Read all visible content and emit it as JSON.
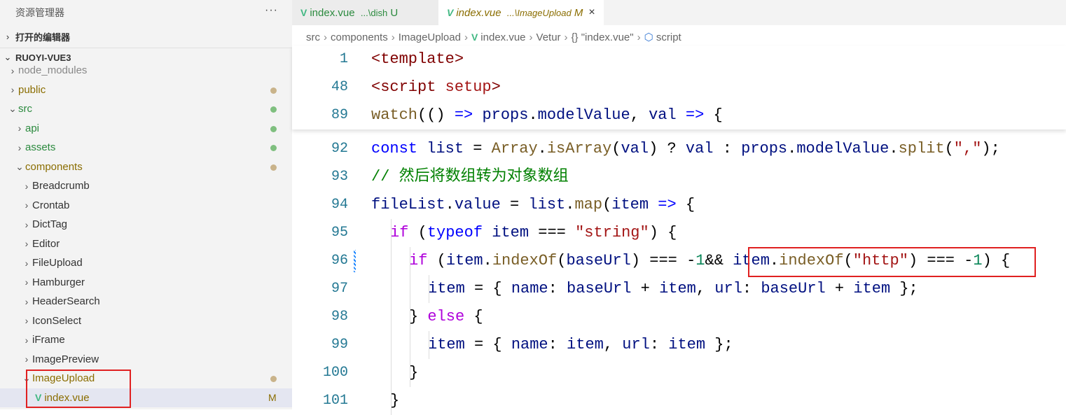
{
  "sidebar": {
    "title": "资源管理器",
    "more": "···",
    "open_editors": "打开的编辑器",
    "project": "RUOYI-VUE3",
    "items": [
      {
        "label": "node_modules",
        "depth": 1,
        "expanded": false,
        "color": "#888",
        "dot": null
      },
      {
        "label": "public",
        "depth": 1,
        "expanded": false,
        "color": "#8a6d00",
        "dot": "#c9b38a"
      },
      {
        "label": "src",
        "depth": 1,
        "expanded": true,
        "color": "#2b8a3e",
        "dot": "#7fbf7f"
      },
      {
        "label": "api",
        "depth": 2,
        "expanded": false,
        "color": "#2b8a3e",
        "dot": "#7fbf7f"
      },
      {
        "label": "assets",
        "depth": 2,
        "expanded": false,
        "color": "#2b8a3e",
        "dot": "#7fbf7f"
      },
      {
        "label": "components",
        "depth": 2,
        "expanded": true,
        "color": "#8a6d00",
        "dot": "#c9b38a"
      },
      {
        "label": "Breadcrumb",
        "depth": 3,
        "expanded": false,
        "color": "#333",
        "dot": null
      },
      {
        "label": "Crontab",
        "depth": 3,
        "expanded": false,
        "color": "#333",
        "dot": null
      },
      {
        "label": "DictTag",
        "depth": 3,
        "expanded": false,
        "color": "#333",
        "dot": null
      },
      {
        "label": "Editor",
        "depth": 3,
        "expanded": false,
        "color": "#333",
        "dot": null
      },
      {
        "label": "FileUpload",
        "depth": 3,
        "expanded": false,
        "color": "#333",
        "dot": null
      },
      {
        "label": "Hamburger",
        "depth": 3,
        "expanded": false,
        "color": "#333",
        "dot": null
      },
      {
        "label": "HeaderSearch",
        "depth": 3,
        "expanded": false,
        "color": "#333",
        "dot": null
      },
      {
        "label": "IconSelect",
        "depth": 3,
        "expanded": false,
        "color": "#333",
        "dot": null
      },
      {
        "label": "iFrame",
        "depth": 3,
        "expanded": false,
        "color": "#333",
        "dot": null
      },
      {
        "label": "ImagePreview",
        "depth": 3,
        "expanded": false,
        "color": "#333",
        "dot": null
      },
      {
        "label": "ImageUpload",
        "depth": 3,
        "expanded": true,
        "color": "#8a6d00",
        "dot": "#c9b38a"
      },
      {
        "label": "index.vue",
        "depth": 4,
        "file": true,
        "color": "#8a6d00",
        "badge": "M",
        "selected": true
      }
    ]
  },
  "tabs": [
    {
      "name": "index.vue",
      "path": "...\\dish",
      "status": "U"
    },
    {
      "name": "index.vue",
      "path": "...\\ImageUpload",
      "status": "M",
      "close": "×"
    }
  ],
  "breadcrumb": [
    "src",
    "components",
    "ImageUpload",
    "index.vue",
    "Vetur",
    "{} \"index.vue\"",
    "script"
  ],
  "sticky": [
    {
      "n": "1",
      "t": [
        [
          "<template>",
          "tg"
        ]
      ]
    },
    {
      "n": "48",
      "t": [
        [
          "<script ",
          "tg"
        ],
        [
          "setup",
          "st"
        ],
        [
          ">",
          "tg"
        ]
      ]
    },
    {
      "n": "89",
      "t": [
        [
          "watch",
          "fn"
        ],
        [
          "(() ",
          ""
        ],
        [
          "=>",
          "bl"
        ],
        [
          " ",
          ""
        ],
        [
          "props",
          "vr"
        ],
        [
          ".",
          ""
        ],
        [
          "modelValue",
          "vr"
        ],
        [
          ", ",
          ""
        ],
        [
          "val",
          "vr"
        ],
        [
          " ",
          ""
        ],
        [
          "=>",
          "bl"
        ],
        [
          " {",
          ""
        ]
      ]
    }
  ],
  "lines": [
    {
      "n": "92",
      "i": 2,
      "t": [
        [
          "const",
          "bl"
        ],
        [
          " ",
          ""
        ],
        [
          "list",
          "vr"
        ],
        [
          " = ",
          ""
        ],
        [
          "Array",
          "fn"
        ],
        [
          ".",
          ""
        ],
        [
          "isArray",
          "fn"
        ],
        [
          "(",
          ""
        ],
        [
          "val",
          "vr"
        ],
        [
          ") ? ",
          ""
        ],
        [
          "val",
          "vr"
        ],
        [
          " : ",
          ""
        ],
        [
          "props",
          "vr"
        ],
        [
          ".",
          ""
        ],
        [
          "modelValue",
          "vr"
        ],
        [
          ".",
          ""
        ],
        [
          "split",
          "fn"
        ],
        [
          "(",
          ""
        ],
        [
          "\",\"",
          "st"
        ],
        [
          ");",
          ""
        ]
      ]
    },
    {
      "n": "93",
      "i": 2,
      "t": [
        [
          "// 然后将数组转为对象数组",
          "cm"
        ]
      ]
    },
    {
      "n": "94",
      "i": 2,
      "t": [
        [
          "fileList",
          "vr"
        ],
        [
          ".",
          ""
        ],
        [
          "value",
          "vr"
        ],
        [
          " = ",
          ""
        ],
        [
          "list",
          "vr"
        ],
        [
          ".",
          ""
        ],
        [
          "map",
          "fn"
        ],
        [
          "(",
          ""
        ],
        [
          "item",
          "vr"
        ],
        [
          " ",
          ""
        ],
        [
          "=>",
          "bl"
        ],
        [
          " {",
          ""
        ]
      ]
    },
    {
      "n": "95",
      "i": 3,
      "t": [
        [
          "if",
          "kw"
        ],
        [
          " (",
          ""
        ],
        [
          "typeof",
          "bl"
        ],
        [
          " ",
          ""
        ],
        [
          "item",
          "vr"
        ],
        [
          " === ",
          ""
        ],
        [
          "\"string\"",
          "st"
        ],
        [
          ") {",
          ""
        ]
      ]
    },
    {
      "n": "96",
      "i": 4,
      "t": [
        [
          "if",
          "kw"
        ],
        [
          " (",
          ""
        ],
        [
          "item",
          "vr"
        ],
        [
          ".",
          ""
        ],
        [
          "indexOf",
          "fn"
        ],
        [
          "(",
          ""
        ],
        [
          "baseUrl",
          "vr"
        ],
        [
          ") === -",
          ""
        ],
        [
          "1",
          "nm"
        ],
        [
          "&& ",
          ""
        ],
        [
          "item",
          "vr"
        ],
        [
          ".",
          ""
        ],
        [
          "indexOf",
          "fn"
        ],
        [
          "(",
          ""
        ],
        [
          "\"http\"",
          "st"
        ],
        [
          ") === -",
          ""
        ],
        [
          "1",
          "nm"
        ],
        [
          ") {",
          ""
        ]
      ]
    },
    {
      "n": "97",
      "i": 5,
      "t": [
        [
          "item",
          "vr"
        ],
        [
          " = { ",
          ""
        ],
        [
          "name",
          "vr"
        ],
        [
          ": ",
          ""
        ],
        [
          "baseUrl",
          "vr"
        ],
        [
          " + ",
          ""
        ],
        [
          "item",
          "vr"
        ],
        [
          ", ",
          ""
        ],
        [
          "url",
          "vr"
        ],
        [
          ": ",
          ""
        ],
        [
          "baseUrl",
          "vr"
        ],
        [
          " + ",
          ""
        ],
        [
          "item",
          "vr"
        ],
        [
          " };",
          ""
        ]
      ]
    },
    {
      "n": "98",
      "i": 4,
      "t": [
        [
          "} ",
          ""
        ],
        [
          "else",
          "kw"
        ],
        [
          " {",
          ""
        ]
      ]
    },
    {
      "n": "99",
      "i": 5,
      "t": [
        [
          "item",
          "vr"
        ],
        [
          " = { ",
          ""
        ],
        [
          "name",
          "vr"
        ],
        [
          ": ",
          ""
        ],
        [
          "item",
          "vr"
        ],
        [
          ", ",
          ""
        ],
        [
          "url",
          "vr"
        ],
        [
          ": ",
          ""
        ],
        [
          "item",
          "vr"
        ],
        [
          " };",
          ""
        ]
      ]
    },
    {
      "n": "100",
      "i": 4,
      "t": [
        [
          "}",
          ""
        ]
      ]
    },
    {
      "n": "101",
      "i": 3,
      "t": [
        [
          "}",
          ""
        ]
      ]
    }
  ]
}
